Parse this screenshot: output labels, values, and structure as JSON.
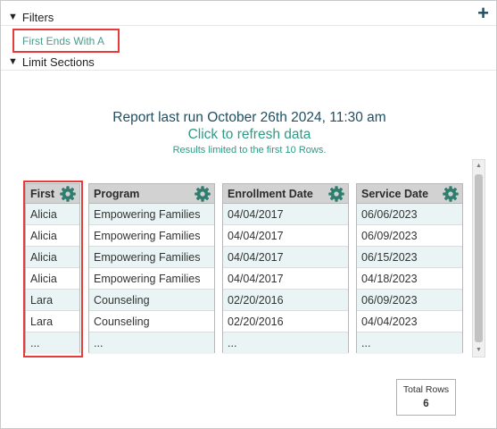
{
  "filters": {
    "label": "Filters",
    "add_icon": "plus-icon",
    "chip": "First Ends With A"
  },
  "limit_sections": {
    "label": "Limit Sections"
  },
  "report": {
    "last_run": "Report last run October 26th 2024, 11:30 am",
    "refresh": "Click to refresh data",
    "limited": "Results limited to the first 10 Rows."
  },
  "table": {
    "columns": [
      "First",
      "Program",
      "Enrollment Date",
      "Service Date"
    ],
    "rows": [
      [
        "Alicia",
        "Empowering Families",
        "04/04/2017",
        "06/06/2023"
      ],
      [
        "Alicia",
        "Empowering Families",
        "04/04/2017",
        "06/09/2023"
      ],
      [
        "Alicia",
        "Empowering Families",
        "04/04/2017",
        "06/15/2023"
      ],
      [
        "Alicia",
        "Empowering Families",
        "04/04/2017",
        "04/18/2023"
      ],
      [
        "Lara",
        "Counseling",
        "02/20/2016",
        "06/09/2023"
      ],
      [
        "Lara",
        "Counseling",
        "02/20/2016",
        "04/04/2023"
      ],
      [
        "...",
        "...",
        "...",
        "..."
      ]
    ]
  },
  "totals": {
    "label": "Total Rows",
    "value": "6"
  },
  "colors": {
    "accent": "#2f9a86",
    "title": "#1f4f62",
    "gear": "#2e7d6e",
    "highlight": "#e53b3b"
  }
}
